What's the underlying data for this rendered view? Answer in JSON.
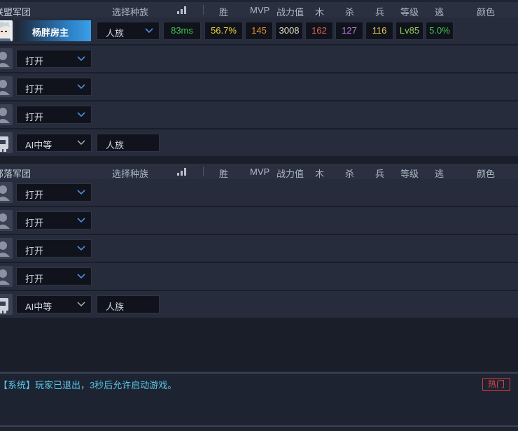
{
  "columns": {
    "race": "选择种族",
    "win": "胜",
    "mvp": "MVP",
    "power": "战力值",
    "wood": "木",
    "kill": "杀",
    "soldier": "兵",
    "level": "等级",
    "escape": "逃",
    "color": "颜色"
  },
  "team1": {
    "name": "联盟军团",
    "host": {
      "player_name": "杨胖",
      "host_tag": "房主",
      "race": "人族",
      "ping": "83ms",
      "win_rate": "56.7%",
      "mvp": "145",
      "power": "3008",
      "wood": "162",
      "kill": "127",
      "soldier": "116",
      "level": "Lv85",
      "escape": "5.0%"
    },
    "open_slots": [
      "打开",
      "打开",
      "打开"
    ],
    "ai": {
      "difficulty": "AI中等",
      "race": "人族"
    }
  },
  "team2": {
    "name": "部落军团",
    "open_slots": [
      "打开",
      "打开",
      "打开",
      "打开"
    ],
    "ai": {
      "difficulty": "AI中等",
      "race": "人族"
    }
  },
  "chat": {
    "message": "【系统】玩家已退出，3秒后允许启动游戏。",
    "hot_button": "热门"
  },
  "colors": {
    "ping": "#3fc34f",
    "win_rate": "#e9d433",
    "mvp": "#e8942a",
    "power": "#e6e0c8",
    "wood": "#e0605a",
    "kill": "#c07ad8",
    "soldier": "#e6c85a",
    "level": "#8fcf5e",
    "escape": "#3fc34f"
  }
}
